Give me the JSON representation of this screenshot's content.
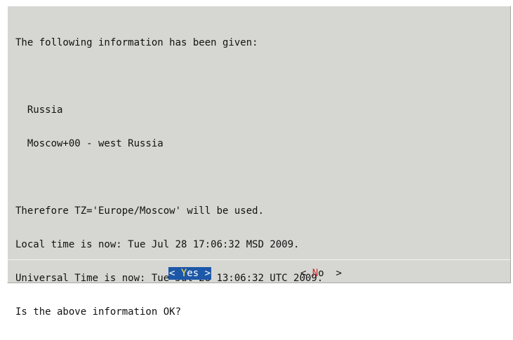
{
  "message": {
    "lines": [
      "The following information has been given:",
      "",
      "  Russia",
      "  Moscow+00 - west Russia",
      "",
      "Therefore TZ='Europe/Moscow' will be used.",
      "Local time is now: Tue Jul 28 17:06:32 MSD 2009.",
      "Universal Time is now: Tue Jul 28 13:06:32 UTC 2009.",
      "Is the above information OK?"
    ]
  },
  "buttons": {
    "yes": {
      "open": "< ",
      "hot": "Y",
      "rest": "es",
      "close": " >"
    },
    "no": {
      "open": "< ",
      "hot": "N",
      "rest": "o",
      "close": "  >"
    }
  },
  "colors": {
    "dialog_bg": "#d6d6d2",
    "selected_bg": "#1d57a8",
    "selected_hotkey": "#ffe84a",
    "hotkey": "#d22b2b"
  }
}
